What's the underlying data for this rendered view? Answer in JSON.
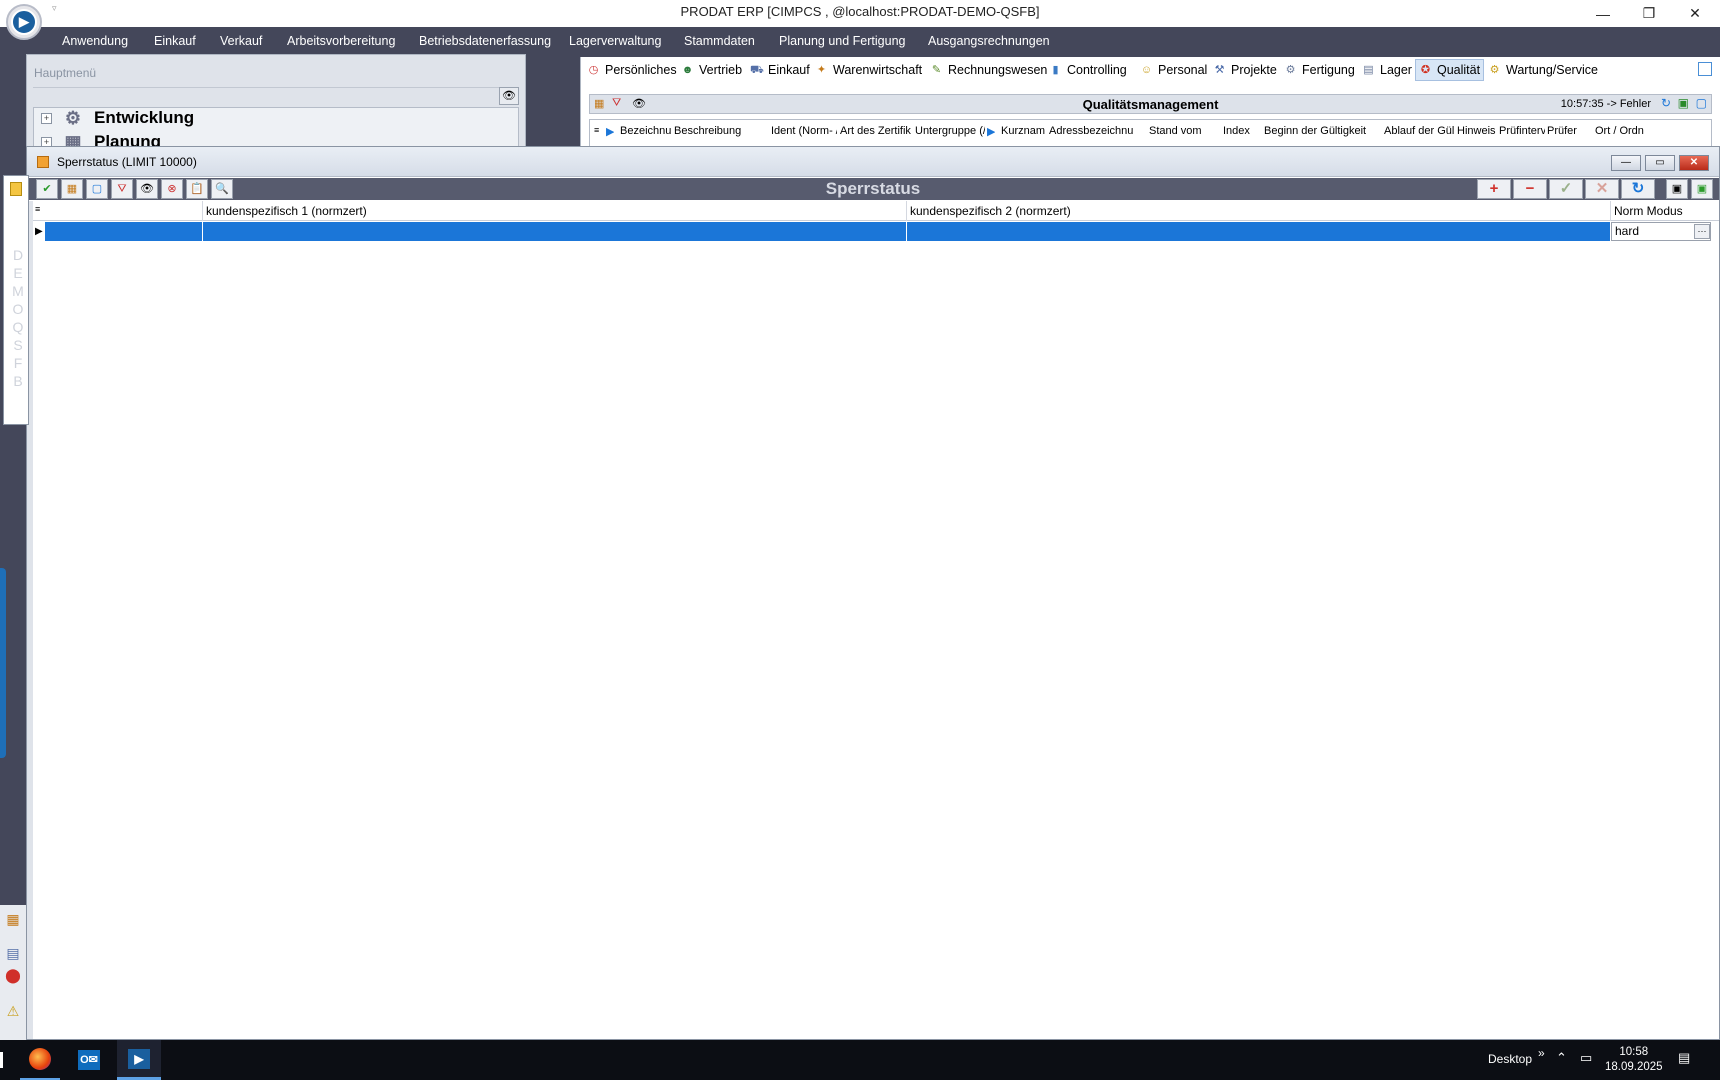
{
  "window": {
    "title": "PRODAT ERP   [CIMPCS ,  @localhost:PRODAT-DEMO-QSFB]",
    "minimize": "—",
    "restore": "❐",
    "close": "✕",
    "qa_arrow": "▿"
  },
  "menu": [
    "Anwendung",
    "Einkauf",
    "Verkauf",
    "Arbeitsvorbereitung",
    "Betriebsdatenerfassung",
    "Lagerverwaltung",
    "Stammdaten",
    "Planung und Fertigung",
    "Ausgangsrechnungen"
  ],
  "hauptmenu": {
    "header": "Hauptmenü",
    "items": [
      "Entwicklung",
      "Planung"
    ]
  },
  "module_tabs": [
    "Persönliches",
    "Vertrieb",
    "Einkauf",
    "Warenwirtschaft",
    "Rechnungswesen",
    "Controlling",
    "Personal",
    "Projekte",
    "Fertigung",
    "Lager",
    "Qualität",
    "Wartung/Service"
  ],
  "active_module": "Qualität",
  "qm": {
    "title": "Qualitätsmanagement",
    "status": "10:57:35 -> Fehler",
    "columns": [
      "Bezeichnu",
      "Beschreibung",
      "Ident (Norm- /",
      "Art des Zertifik",
      "Untergruppe (/",
      "Kurznam",
      "Adressbezeichnu",
      "Stand vom",
      "Index",
      "Beginn der Gültigkeit",
      "Ablauf der Gül",
      "Hinweis",
      "Prüfinterv",
      "Prüfer",
      "Ort / Ordn"
    ]
  },
  "sperrstatus": {
    "window_title": "Sperrstatus (LIMIT 10000)",
    "heading": "Sperrstatus",
    "columns": [
      "",
      "kundenspezifisch 1 (normzert)",
      "kundenspezifisch 2 (normzert)",
      "Norm Modus"
    ],
    "row": {
      "norm_modus": "hard",
      "ellipsis": "···",
      "indicator": "▶"
    },
    "actions": {
      "add": "+",
      "remove": "−",
      "confirm": "✓",
      "cancel": "✕",
      "refresh": "↻"
    }
  },
  "side_dock": {
    "vertical_text": "DEMO QSFB"
  },
  "taskbar": {
    "desktop_label": "Desktop",
    "chevron": "»",
    "time": "10:58",
    "date": "18.09.2025"
  },
  "colors": {
    "selection": "#1b76d8",
    "menubar": "#44475a",
    "toolbar": "#575b6e"
  }
}
